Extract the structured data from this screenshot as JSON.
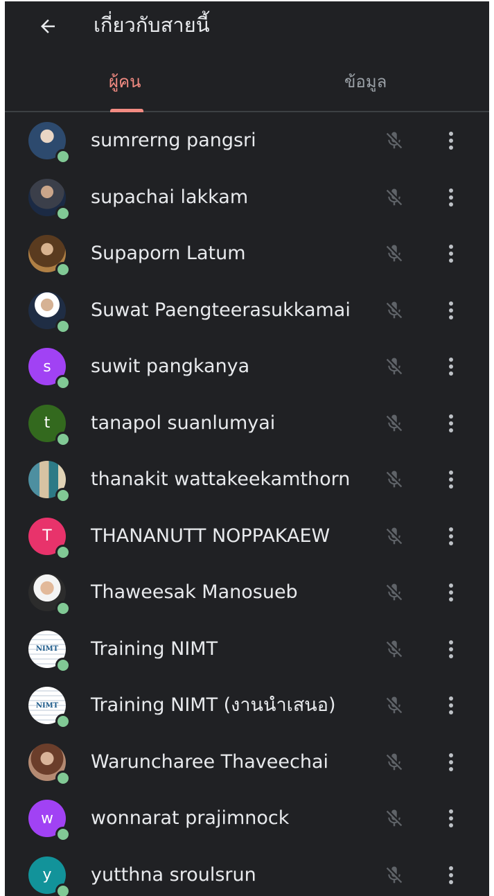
{
  "header": {
    "title": "เกี่ยวกับสายนี้",
    "back_icon": "arrow-back-icon"
  },
  "tabs": [
    {
      "label": "ผู้คน",
      "active": true
    },
    {
      "label": "ข้อมูล",
      "active": false
    }
  ],
  "colors": {
    "background": "#202124",
    "accent": "#f28b82",
    "presence": "#81c995",
    "text": "#e8eaed",
    "muted": "#9aa0a6"
  },
  "participants": [
    {
      "name": "sumrerng pangsri",
      "avatar": "photo",
      "muted": true
    },
    {
      "name": "supachai lakkam",
      "avatar": "photo",
      "muted": true
    },
    {
      "name": "Supaporn Latum",
      "avatar": "photo",
      "muted": true
    },
    {
      "name": "Suwat Paengteerasukkamai",
      "avatar": "photo",
      "muted": true
    },
    {
      "name": "suwit pangkanya",
      "avatar": "s",
      "avatar_color": "#a142f4",
      "muted": true
    },
    {
      "name": "tanapol suanlumyai",
      "avatar": "t",
      "avatar_color": "#33691e",
      "muted": true
    },
    {
      "name": "thanakit wattakeekamthorn",
      "avatar": "photo",
      "muted": true
    },
    {
      "name": "THANANUTT NOPPAKAEW",
      "avatar": "T",
      "avatar_color": "#e8336b",
      "muted": true
    },
    {
      "name": "Thaweesak Manosueb",
      "avatar": "photo",
      "muted": true
    },
    {
      "name": "Training NIMT",
      "avatar": "photo",
      "avatar_text": "NIMT",
      "muted": true
    },
    {
      "name": "Training NIMT (งานนำเสนอ)",
      "avatar": "photo",
      "avatar_text": "NIMT",
      "muted": true
    },
    {
      "name": "Waruncharee Thaveechai",
      "avatar": "photo",
      "muted": true
    },
    {
      "name": "wonnarat prajimnock",
      "avatar": "w",
      "avatar_color": "#a142f4",
      "muted": true
    },
    {
      "name": "yutthna sroulsrun",
      "avatar": "y",
      "avatar_color": "#12939a",
      "muted": true
    }
  ]
}
